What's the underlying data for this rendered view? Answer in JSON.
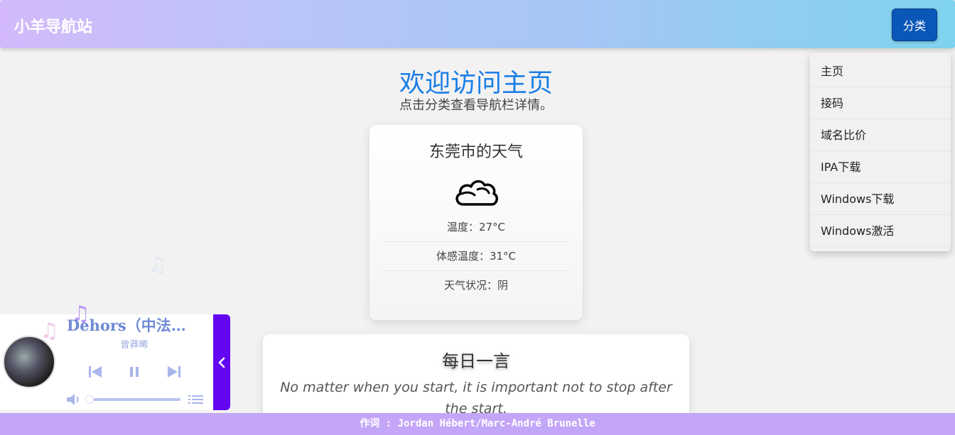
{
  "header": {
    "site_title": "小羊导航站",
    "menu_button_label": "分类"
  },
  "dropdown": {
    "items": [
      {
        "label": "主页"
      },
      {
        "label": "接码"
      },
      {
        "label": "域名比价"
      },
      {
        "label": "IPA下载"
      },
      {
        "label": "Windows下载"
      },
      {
        "label": "Windows激活"
      }
    ]
  },
  "welcome": {
    "title": "欢迎访问主页",
    "subtitle": "点击分类查看导航栏详情。"
  },
  "weather": {
    "title": "东莞市的天气",
    "icon": "cloud-icon",
    "temperature": "温度：27°C",
    "feels_like": "体感温度：31°C",
    "condition": "天气状况：阴"
  },
  "quote": {
    "title": "每日一言",
    "text": "No matter when you start, it is important not to stop after the start."
  },
  "player": {
    "song_title": "Dehors（中法…",
    "artist": "曾莽晞",
    "volume_level": 0.02,
    "colors": {
      "accent": "#6206f2",
      "text": "#6f8ad6"
    }
  },
  "lyrics": {
    "line": "作词 : Jordan Hébert/Marc-André Brunelle"
  },
  "colors": {
    "primary_button": "#0a57b8",
    "welcome_title": "#1a7ee6",
    "lyrics_bar": "#c4a6f9"
  }
}
